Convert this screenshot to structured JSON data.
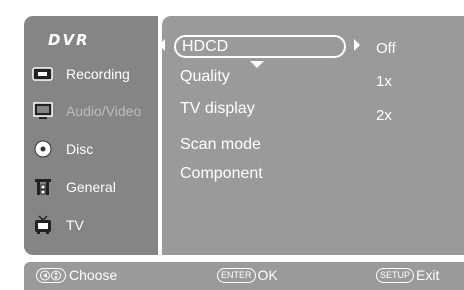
{
  "sidebar": {
    "brand": "DVR",
    "items": [
      {
        "label": "Recording",
        "icon": "recording-icon"
      },
      {
        "label": "Audio/Video",
        "icon": "monitor-icon"
      },
      {
        "label": "Disc",
        "icon": "disc-icon"
      },
      {
        "label": "General",
        "icon": "general-icon"
      },
      {
        "label": "TV",
        "icon": "tv-icon"
      }
    ]
  },
  "main": {
    "items": [
      {
        "label": "HDCD"
      },
      {
        "label": "Quality"
      },
      {
        "label": "TV display"
      },
      {
        "label": "Scan mode"
      },
      {
        "label": "Component"
      }
    ],
    "options": [
      "Off",
      "1x",
      "2x"
    ]
  },
  "footer": {
    "choose_label": "Choose",
    "enter_key": "ENTER",
    "ok_label": "OK",
    "setup_key": "SETUP",
    "exit_label": "Exit"
  },
  "colors": {
    "sidebar_bg": "#858585",
    "panel_bg": "#9a9a9a",
    "text": "#ffffff",
    "dim_text": "#bcbcbc"
  }
}
